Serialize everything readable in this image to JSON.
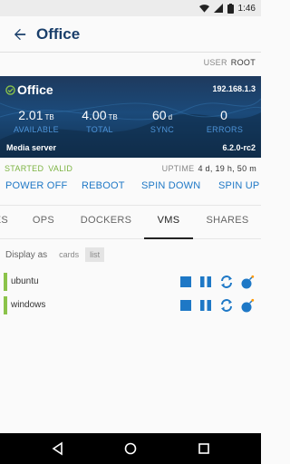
{
  "status_bar": {
    "time": "1:46",
    "icons": [
      "wifi-icon",
      "signal-icon",
      "battery-icon"
    ]
  },
  "appbar": {
    "title": "Office",
    "back_icon": "arrow-back-icon"
  },
  "user": {
    "label": "USER",
    "value": "ROOT"
  },
  "server": {
    "name": "Office",
    "ip": "192.168.1.3",
    "type": "Media server",
    "version": "6.2.0-rc2",
    "online_icon": "check-circle-icon",
    "stats": [
      {
        "value": "2.01",
        "unit": "TB",
        "label": "AVAILABLE"
      },
      {
        "value": "4.00",
        "unit": "TB",
        "label": "TOTAL"
      },
      {
        "value": "60",
        "unit": "d",
        "label": "SYNC"
      },
      {
        "value": "0",
        "unit": "",
        "label": "ERRORS"
      }
    ]
  },
  "state": {
    "started": "STARTED",
    "valid": "VALID",
    "uptime_label": "UPTIME",
    "uptime_value": "4 d, 19 h, 50 m"
  },
  "actions": [
    "POWER OFF",
    "REBOOT",
    "SPIN DOWN",
    "SPIN UP"
  ],
  "tabs": [
    "ES",
    "OPS",
    "DOCKERS",
    "VMS",
    "SHARES"
  ],
  "active_tab": "VMS",
  "display": {
    "label": "Display as",
    "options": [
      "cards",
      "list"
    ],
    "selected": "list"
  },
  "vms": [
    {
      "name": "ubuntu",
      "status_color": "#8bc34a"
    },
    {
      "name": "windows",
      "status_color": "#8bc34a"
    }
  ],
  "vm_controls": [
    "stop-icon",
    "pause-icon",
    "restart-icon",
    "force-stop-icon"
  ],
  "colors": {
    "accent": "#1e78c6",
    "title": "#1a3f6b",
    "started": "#7cb342",
    "banner": "#1b4a7a"
  }
}
